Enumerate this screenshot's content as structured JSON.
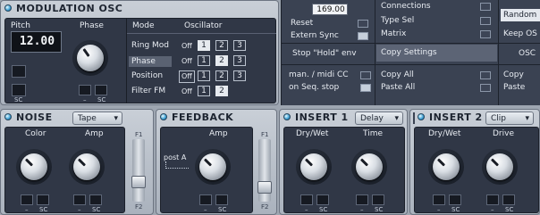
{
  "mod_osc": {
    "title": "MODULATION OSC",
    "pitch_label": "Pitch",
    "pitch_value": "12.00",
    "phase_label": "Phase",
    "mode_header": "Mode",
    "osc_header": "Oscillator",
    "rows": [
      {
        "label": "Ring Mod",
        "off": "Off",
        "b1": "1",
        "b2": "2",
        "b3": "3"
      },
      {
        "label": "Phase",
        "off": "Off",
        "b1": "1",
        "b2": "2",
        "b3": "3"
      },
      {
        "label": "Position",
        "off": "Off",
        "b1": "1",
        "b2": "2",
        "b3": "3"
      },
      {
        "label": "Filter FM",
        "off": "Off",
        "b1": "1",
        "b2": "2"
      }
    ],
    "minus": "–",
    "sc": "SC"
  },
  "settings": {
    "value_box": "169.00",
    "reset": "Reset",
    "extern_sync": "Extern Sync",
    "connections": "Connections",
    "type_sel": "Type Sel",
    "matrix": "Matrix",
    "random": "Random",
    "keep_os": "Keep OS",
    "stop_hold": "Stop \"Hold\" env",
    "copy_settings": "Copy Settings",
    "osc": "OSC",
    "man_midi_cc": "man. / midi CC",
    "on_seq_stop": "on Seq. stop",
    "copy_all": "Copy All",
    "paste_all": "Paste All",
    "copy": "Copy",
    "paste": "Paste"
  },
  "noise": {
    "title": "NOISE",
    "dropdown": "Tape",
    "color_label": "Color",
    "amp_label": "Amp",
    "f1": "F1",
    "f2": "F2"
  },
  "feedback": {
    "title": "FEEDBACK",
    "amp_label": "Amp",
    "post_label": "post A",
    "f1": "F1",
    "f2": "F2"
  },
  "insert1": {
    "title": "INSERT 1",
    "dropdown": "Delay",
    "drywet_label": "Dry/Wet",
    "time_label": "Time"
  },
  "insert2": {
    "title": "INSERT 2",
    "dropdown": "Clip",
    "drywet_label": "Dry/Wet",
    "drive_label": "Drive"
  },
  "common": {
    "minus": "–",
    "sc": "SC"
  }
}
